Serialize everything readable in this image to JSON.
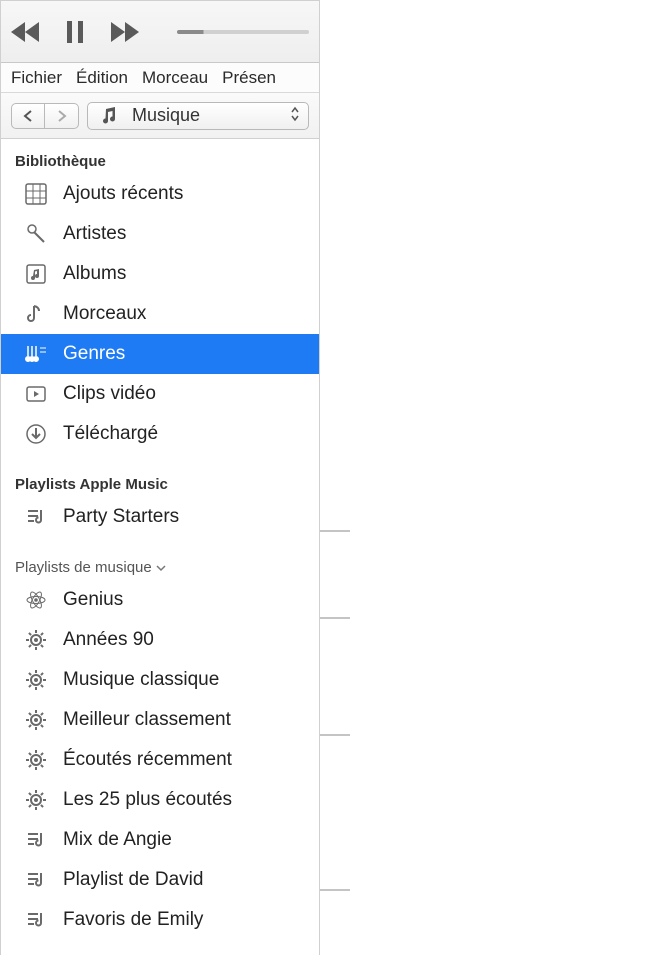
{
  "menubar": {
    "items": [
      "Fichier",
      "Édition",
      "Morceau",
      "Présen"
    ]
  },
  "toolbar": {
    "media_selector_label": "Musique"
  },
  "sidebar": {
    "section_library": "Bibliothèque",
    "library": [
      {
        "label": "Ajouts récents",
        "icon": "grid-icon"
      },
      {
        "label": "Artistes",
        "icon": "mic-icon"
      },
      {
        "label": "Albums",
        "icon": "album-icon"
      },
      {
        "label": "Morceaux",
        "icon": "note-icon"
      },
      {
        "label": "Genres",
        "icon": "guitars-icon",
        "selected": true
      },
      {
        "label": "Clips vidéo",
        "icon": "video-icon"
      },
      {
        "label": "Téléchargé",
        "icon": "download-icon"
      }
    ],
    "section_apple": "Playlists Apple Music",
    "apple_playlists": [
      {
        "label": "Party Starters",
        "icon": "playlist-icon"
      }
    ],
    "section_music_playlists": "Playlists de musique",
    "genius": {
      "label": "Genius",
      "icon": "atom-icon"
    },
    "smart_playlists": [
      {
        "label": "Années 90",
        "icon": "gear-icon"
      },
      {
        "label": "Musique classique",
        "icon": "gear-icon"
      },
      {
        "label": "Meilleur classement",
        "icon": "gear-icon"
      },
      {
        "label": "Écoutés récemment",
        "icon": "gear-icon"
      },
      {
        "label": "Les 25 plus écoutés",
        "icon": "gear-icon"
      }
    ],
    "user_playlists": [
      {
        "label": "Mix de Angie",
        "icon": "playlist-icon"
      },
      {
        "label": "Playlist de David",
        "icon": "playlist-icon"
      },
      {
        "label": "Favoris de Emily",
        "icon": "playlist-icon"
      }
    ]
  }
}
